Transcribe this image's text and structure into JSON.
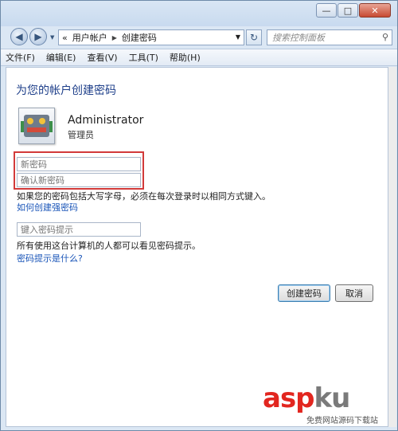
{
  "window": {
    "controls": {
      "minimize": "—",
      "maximize": "□",
      "close": "✕"
    }
  },
  "nav": {
    "back_icon": "back-arrow-icon",
    "forward_icon": "forward-arrow-icon",
    "breadcrumb_prefix": "«",
    "breadcrumbs": [
      "用户帐户",
      "创建密码"
    ],
    "search_placeholder": "搜索控制面板"
  },
  "menu": [
    "文件(F)",
    "编辑(E)",
    "查看(V)",
    "工具(T)",
    "帮助(H)"
  ],
  "main": {
    "heading": "为您的帐户创建密码",
    "user": {
      "name": "Administrator",
      "role": "管理员"
    },
    "new_password_placeholder": "新密码",
    "confirm_password_placeholder": "确认新密码",
    "hint_text": "如果您的密码包括大写字母，必须在每次登录时以相同方式键入。",
    "strong_link": "如何创建强密码",
    "password_hint_placeholder": "键入密码提示",
    "hint_visibility_text": "所有使用这台计算机的人都可以看见密码提示。",
    "hint_what_link": "密码提示是什么?",
    "create_button": "创建密码",
    "cancel_button": "取消"
  },
  "watermark": {
    "asp": "asp",
    "ku": "ku",
    "sub": "免费网站源码下载站"
  },
  "colors": {
    "heading": "#1e3f8a",
    "link": "#1a55b8",
    "highlight_box": "#d23a3a"
  }
}
